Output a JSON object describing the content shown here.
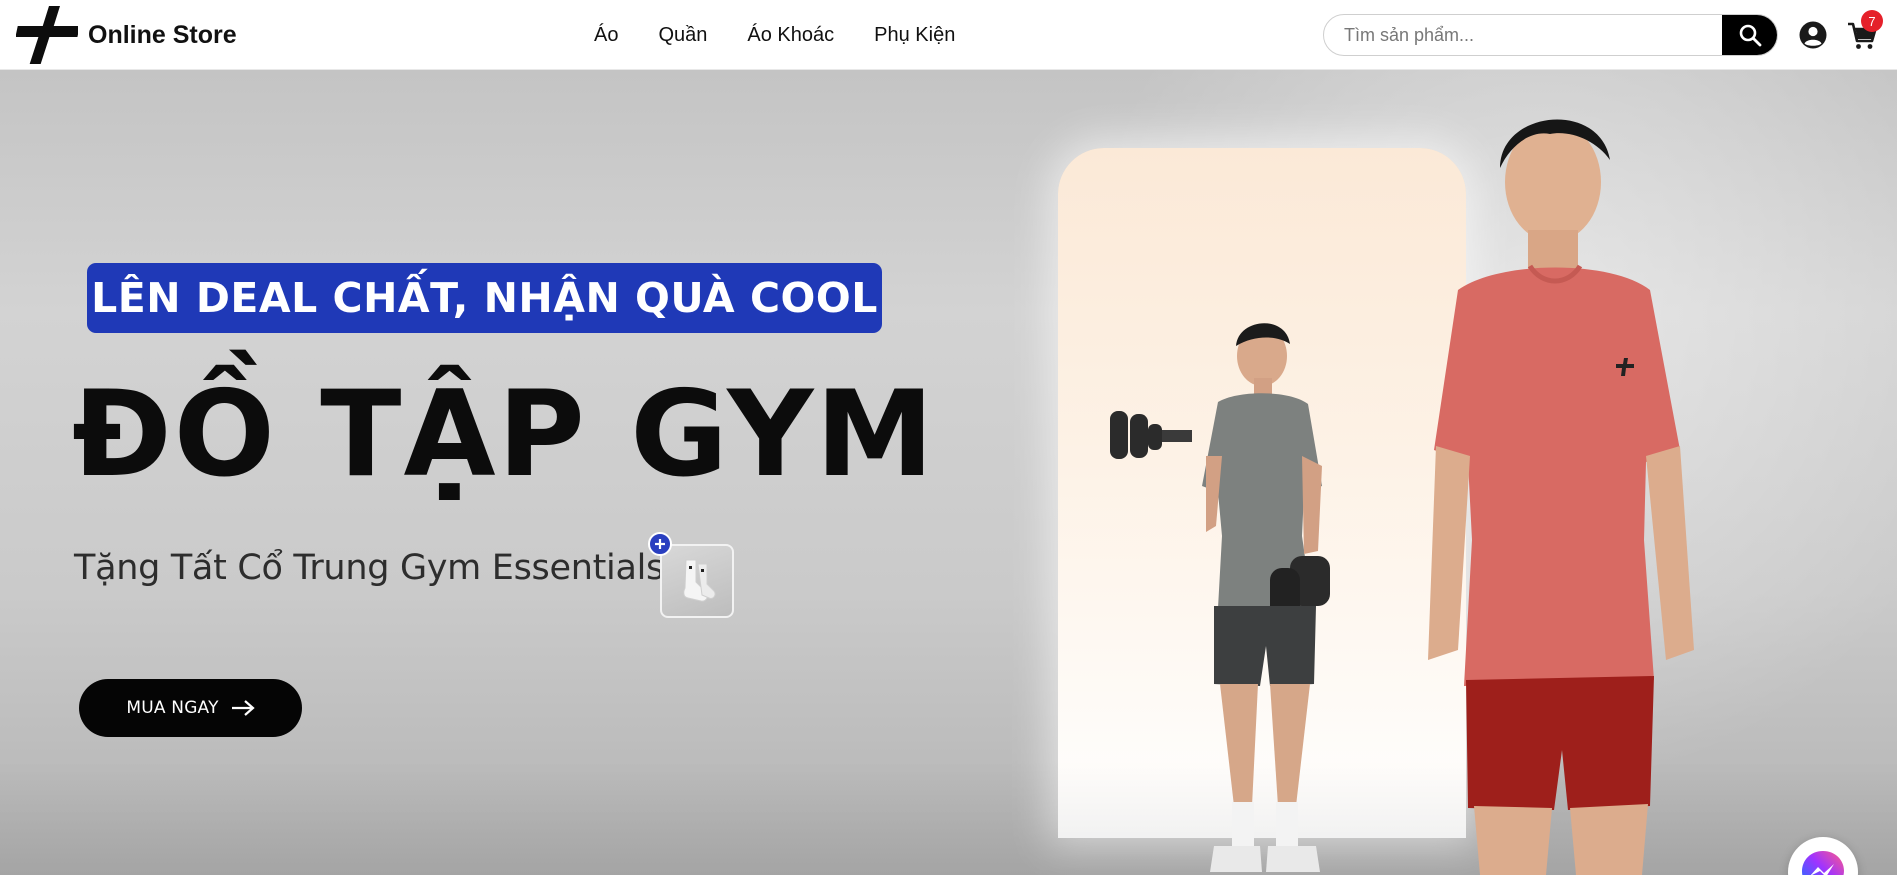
{
  "header": {
    "brand_name": "Online Store",
    "nav": [
      {
        "label": "Áo"
      },
      {
        "label": "Quần"
      },
      {
        "label": "Áo Khoác"
      },
      {
        "label": "Phụ Kiện"
      }
    ],
    "search": {
      "placeholder": "Tìm sản phẩm..."
    },
    "cart_count": "7"
  },
  "hero": {
    "promo_label": "LÊN DEAL CHẤT, NHẬN QUÀ COOL",
    "title": "ĐỒ TẬP GYM",
    "subtitle": "Tặng Tất Cổ Trung Gym Essentials",
    "cta_label": "MUA NGAY"
  },
  "icons": {
    "logo": "logo-icon",
    "search": "search-icon",
    "account": "user-circle-icon",
    "cart": "cart-icon",
    "cta_arrow": "arrow-right-icon",
    "gift_plus": "plus-icon",
    "messenger": "messenger-icon"
  },
  "colors": {
    "accent_blue": "#1f39b7",
    "badge_red": "#e5202a",
    "cta_black": "#050505",
    "shirt_red": "#d86a63",
    "shirt_grey": "#7d817f"
  }
}
